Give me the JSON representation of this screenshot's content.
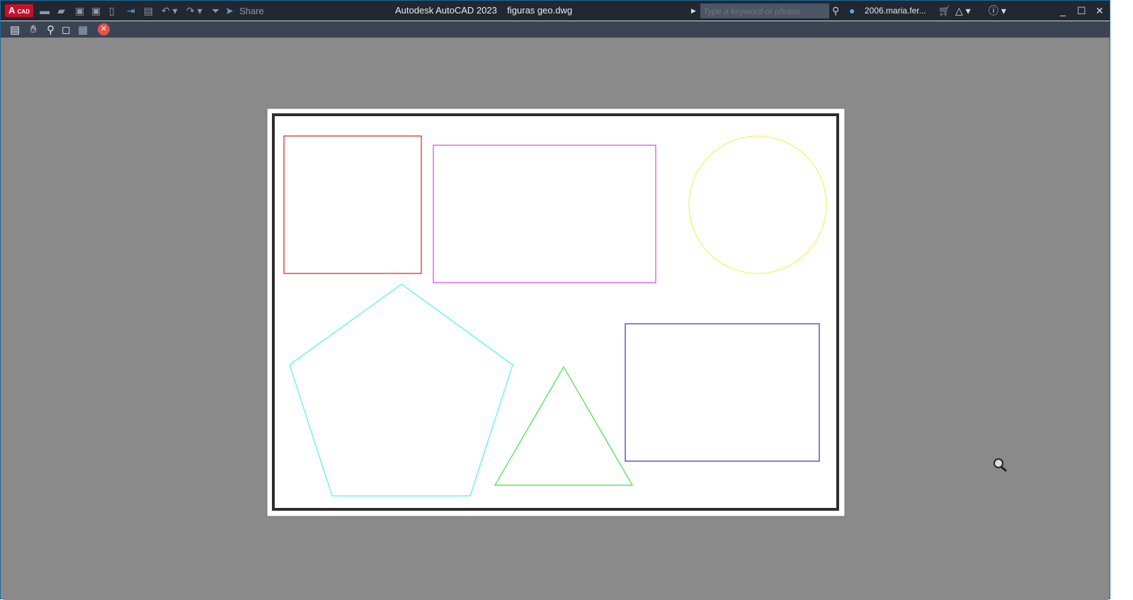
{
  "app": {
    "logo": "A",
    "logo_sub": "CAD",
    "title": "Autodesk AutoCAD 2023",
    "file": "figuras geo.dwg"
  },
  "quick_access": {
    "share_label": "Share",
    "icons": [
      "new-icon",
      "open-icon",
      "save-icon",
      "save-as-icon",
      "publish-icon",
      "import-icon",
      "print-icon",
      "undo-icon",
      "redo-icon",
      "customize-icon",
      "share-icon"
    ]
  },
  "search": {
    "placeholder": "Type a keyword or phrase"
  },
  "user": {
    "name": "2006.maria.fer..."
  },
  "preview_toolbar": {
    "icons": [
      "plot-icon",
      "pan-icon",
      "zoom-icon",
      "zoom-window-icon",
      "zoom-original-icon",
      "close-preview-icon"
    ]
  },
  "colors": {
    "square": "#d42020",
    "rectangle": "#e040e0",
    "circle": "#f5f060",
    "pentagon": "#50f0f0",
    "triangle": "#40e040",
    "blue_rectangle": "#3030c0",
    "border": "#2e2e2e"
  }
}
